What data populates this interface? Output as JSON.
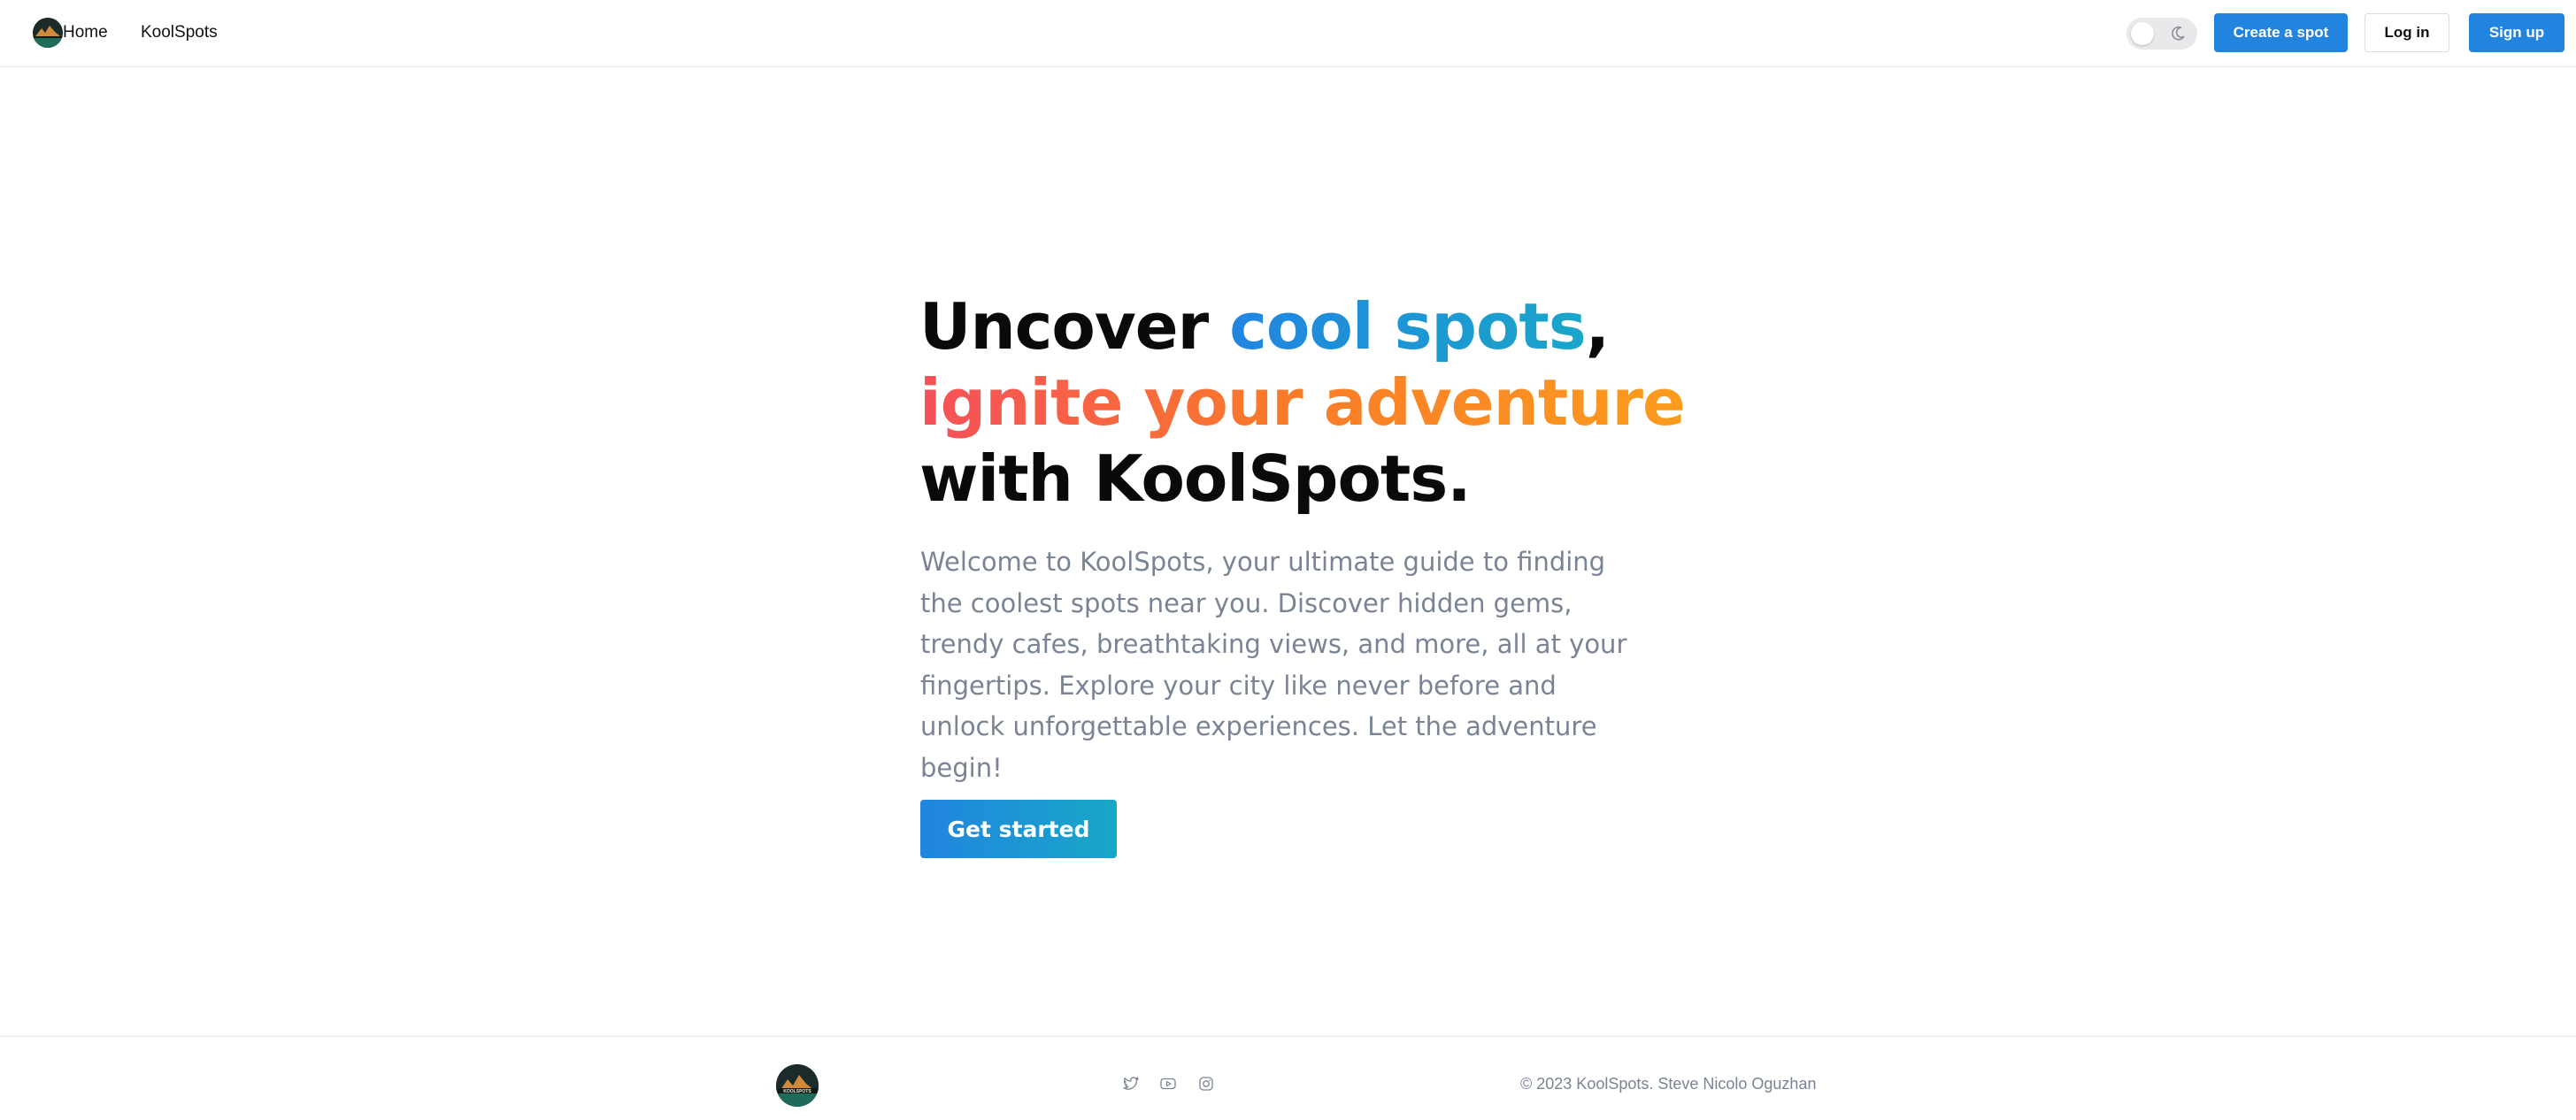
{
  "header": {
    "brand_label": "Home",
    "nav_link": "KoolSpots",
    "create_spot_label": "Create a spot",
    "login_label": "Log in",
    "signup_label": "Sign up",
    "theme_toggle_icon": "moon-icon"
  },
  "hero": {
    "title_line1_pre": "Uncover ",
    "title_line1_highlight": "cool spots",
    "title_line1_post": ",",
    "title_line2": "ignite your adventure",
    "title_line3": "with KoolSpots.",
    "description": "Welcome to KoolSpots, your ultimate guide to finding the coolest spots near you. Discover hidden gems, trendy cafes, breathtaking views, and more, all at your fingertips. Explore your city like never before and unlock unforgettable experiences. Let the adventure begin!",
    "cta_label": "Get started"
  },
  "footer": {
    "logo_text": "KOOLSPOTS",
    "social_icons": [
      "twitter-icon",
      "youtube-icon",
      "instagram-icon"
    ],
    "copyright": "© 2023 KoolSpots. Steve Nicolo Oguzhan"
  },
  "colors": {
    "primary": "#2185e0",
    "primary_gradient_end": "#17a7c6",
    "accent_gradient_start": "#f5505a",
    "accent_gradient_end": "#fb9f1c",
    "muted_text": "#7a8494"
  }
}
